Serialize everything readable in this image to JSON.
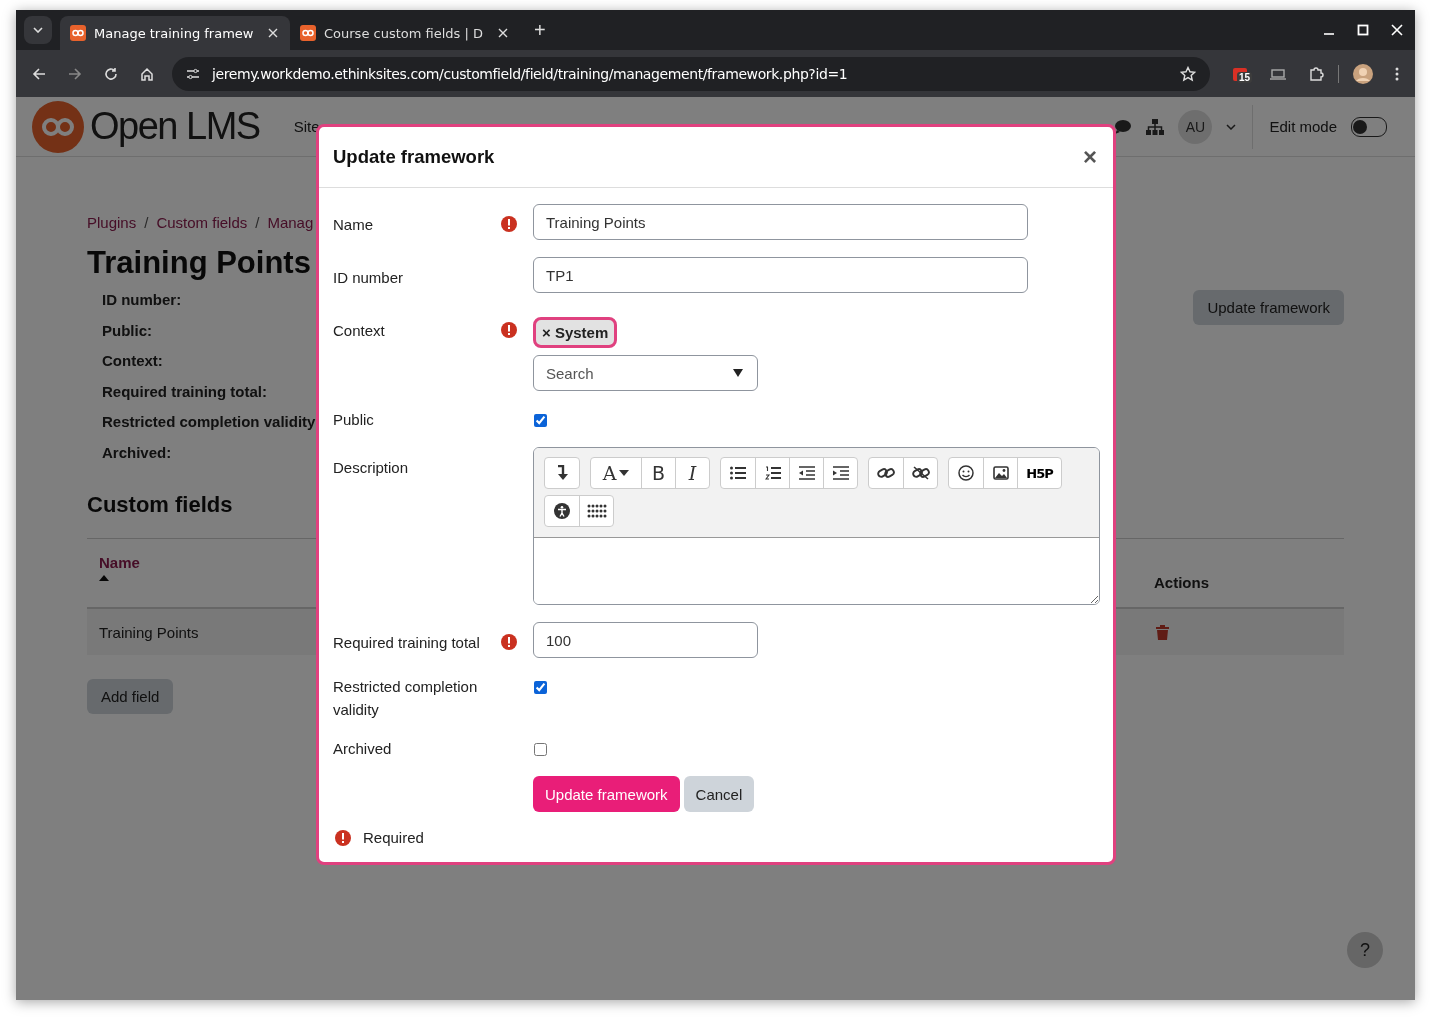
{
  "browser": {
    "tabs": [
      {
        "title": "Manage training framew",
        "selected": true
      },
      {
        "title": "Course custom fields | D",
        "selected": false
      }
    ],
    "new_tab": "+",
    "address": "jeremy.workdemo.ethinksites.com/customfield/field/training/management/framework.php?id=1",
    "calendar_badge": "15"
  },
  "site_header": {
    "logo": "Open LMS",
    "nav": [
      "Site"
    ],
    "user_initials": "AU",
    "edit_mode": {
      "label": "Edit mode",
      "on": false
    }
  },
  "page": {
    "breadcrumb": [
      "Plugins",
      "Custom fields",
      "Manag"
    ],
    "breadcrumb_separator": "/",
    "title": "Training Points",
    "details": [
      "ID number:",
      "Public:",
      "Context:",
      "Required training total:",
      "Restricted completion validity",
      "Archived:"
    ],
    "update_button": "Update framework",
    "section_title": "Custom fields",
    "table": {
      "columns": [
        {
          "label": "Name",
          "sorted": true
        },
        {
          "label": "Actions",
          "sorted": false
        }
      ],
      "rows": [
        {
          "name": "Training Points"
        }
      ]
    },
    "add_button": "Add field",
    "help": "?"
  },
  "modal": {
    "title": "Update framework",
    "close": "×",
    "fields": [
      {
        "kind": "text",
        "label": "Name",
        "required": true,
        "value": "Training Points"
      },
      {
        "kind": "text",
        "label": "ID number",
        "required": false,
        "value": "TP1"
      },
      {
        "kind": "autocomplete",
        "label": "Context",
        "required": true,
        "chips": [
          {
            "remove": "×",
            "label": "System"
          }
        ],
        "placeholder": "Search"
      },
      {
        "kind": "checkbox",
        "label": "Public",
        "required": false,
        "checked": true
      },
      {
        "kind": "editor",
        "label": "Description",
        "required": false,
        "toolbar_text": {
          "font": "A",
          "bold": "B",
          "italic": "I",
          "h5p": "H5P"
        }
      },
      {
        "kind": "number",
        "label": "Required training total",
        "required": true,
        "value": "100"
      },
      {
        "kind": "checkbox",
        "label": "Restricted completion validity",
        "required": false,
        "checked": true
      },
      {
        "kind": "checkbox",
        "label": "Archived",
        "required": false,
        "checked": false
      }
    ],
    "buttons": [
      {
        "label": "Update framework",
        "kind": "primary"
      },
      {
        "label": "Cancel",
        "kind": "secondary"
      }
    ],
    "required_note": "Required"
  }
}
